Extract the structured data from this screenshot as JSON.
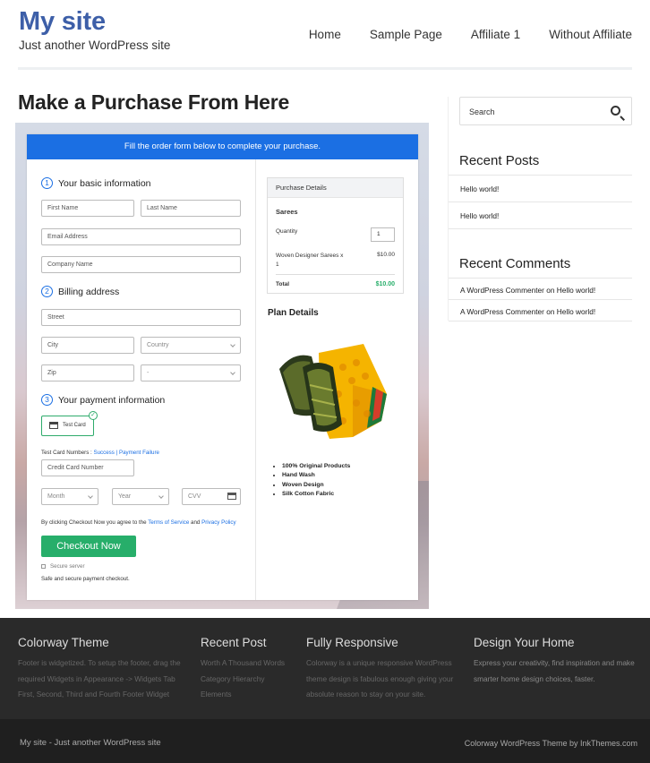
{
  "site": {
    "title": "My site",
    "tagline": "Just another WordPress site"
  },
  "nav": [
    "Home",
    "Sample Page",
    "Affiliate 1",
    "Without Affiliate"
  ],
  "page": {
    "heading": "Make a Purchase From Here"
  },
  "form": {
    "banner": "Fill the order form below to complete your purchase.",
    "section1": {
      "num": "1",
      "title": "Your basic information"
    },
    "first_name": "First Name",
    "last_name": "Last Name",
    "email": "Email Address",
    "company": "Company Name",
    "section2": {
      "num": "2",
      "title": "Billing address"
    },
    "street": "Street",
    "city": "City",
    "country": "Country",
    "zip": "Zip",
    "state": "-",
    "section3": {
      "num": "3",
      "title": "Your payment information"
    },
    "test_card": "Test Card",
    "test_card_numbers_label": "Test Card Numbers :",
    "success_link": "Success",
    "separator": "|",
    "failure_link": "Payment Failure",
    "credit_card_number": "Credit Card Number",
    "month": "Month",
    "year": "Year",
    "cvv": "CVV",
    "terms_prefix": "By clicking Checkout Now you agree to the",
    "terms_link": "Terms of Service",
    "terms_and": "and",
    "privacy_link": "Privacy Policy",
    "checkout_button": "Checkout Now",
    "secure_server": "Secure server",
    "safe_text": "Safe and secure payment checkout."
  },
  "purchase": {
    "header": "Purchase Details",
    "product": "Sarees",
    "quantity_label": "Quantity",
    "quantity_value": "1",
    "item_name_line1": "Woven Designer Sarees x",
    "item_name_line2": "1",
    "item_price": "$10.00",
    "total_label": "Total",
    "total_value": "$10.00"
  },
  "plan": {
    "title": "Plan Details",
    "features": [
      "100% Original Products",
      "Hand Wash",
      "Woven Design",
      "Silk Cotton Fabric"
    ]
  },
  "sidebar": {
    "search_placeholder": "Search",
    "recent_posts_title": "Recent Posts",
    "recent_posts": [
      "Hello world!",
      "Hello world!"
    ],
    "recent_comments_title": "Recent Comments",
    "recent_comments": [
      {
        "author": "A WordPress Commenter",
        "on": "on",
        "post": "Hello world!"
      },
      {
        "author": "A WordPress Commenter",
        "on": "on",
        "post": "Hello world!"
      }
    ]
  },
  "footer": {
    "columns": [
      {
        "title": "Colorway Theme",
        "lines": [
          "Footer is widgetized. To setup the footer, drag the",
          "required Widgets in Appearance -> Widgets Tab",
          "First, Second, Third and Fourth Footer Widget"
        ]
      },
      {
        "title": "Recent Post",
        "lines": [
          "Worth A Thousand Words",
          "Category Hierarchy",
          "Elements"
        ]
      },
      {
        "title": "Fully Responsive",
        "lines": [
          "Colorway is a unique responsive WordPress",
          "theme design is fabulous enough giving your",
          "absolute reason to stay on your site."
        ]
      },
      {
        "title": "Design Your Home",
        "lines": [
          "Express your creativity, find inspiration and make",
          "smarter home design choices, faster."
        ]
      }
    ],
    "bottom_left": "My site - Just another WordPress site",
    "bottom_right": "Colorway WordPress Theme by InkThemes.com"
  },
  "colors": {
    "brand": "#3d5fa8",
    "banner": "#1b6fe3",
    "checkout": "#27ae6a",
    "footer_bg": "#2a2a2a"
  }
}
